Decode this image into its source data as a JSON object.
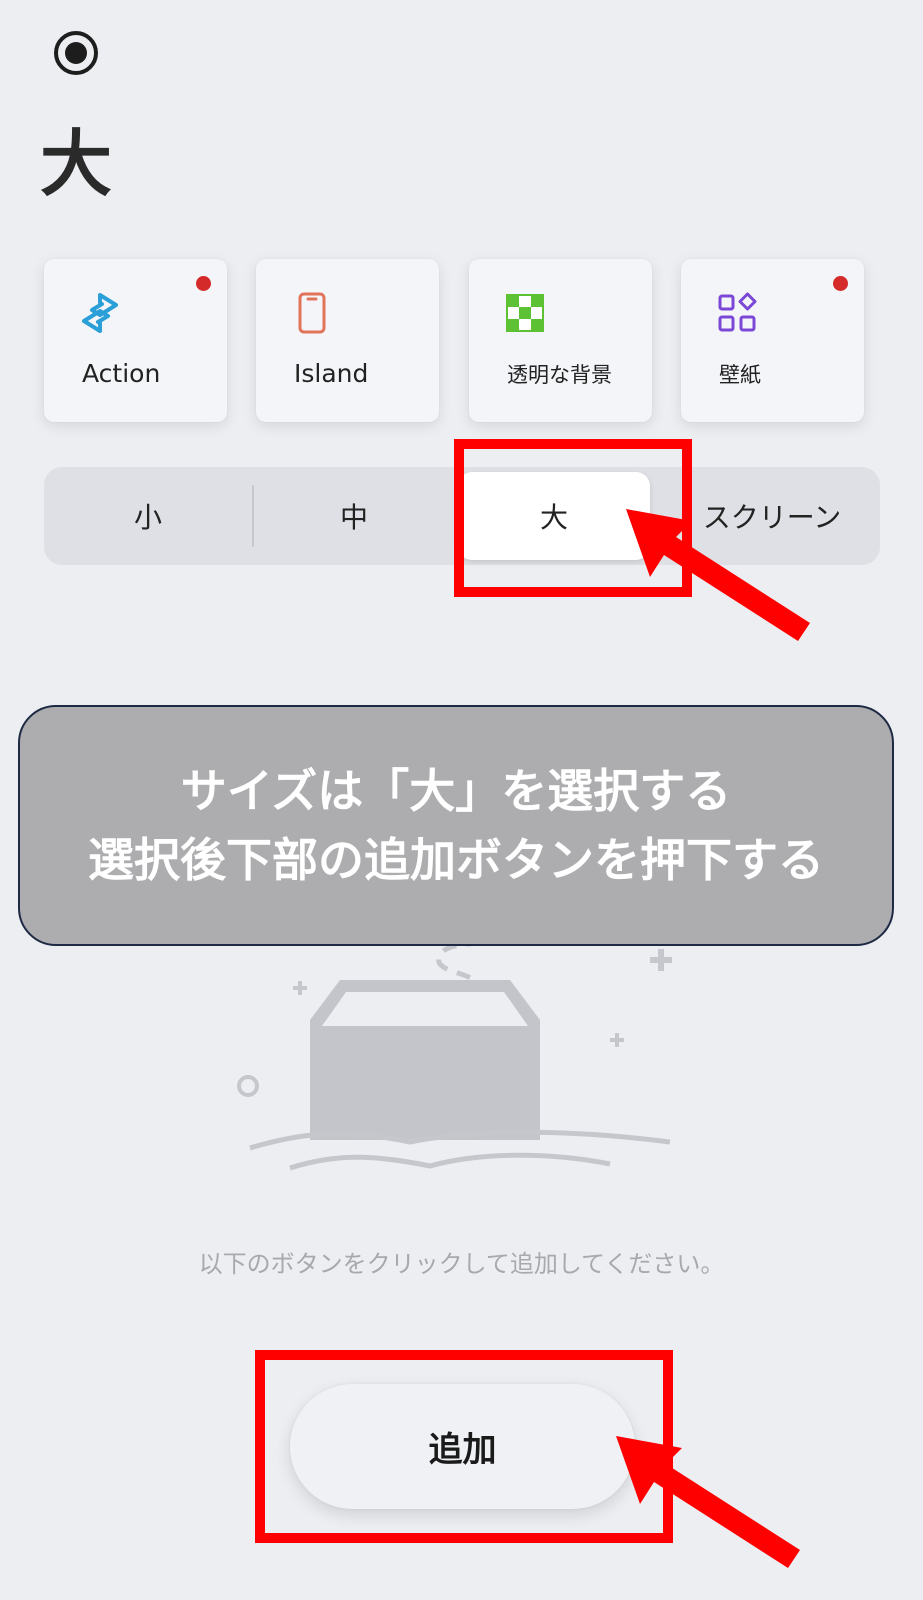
{
  "header": {
    "radio_selected": true,
    "title": "大"
  },
  "cards": [
    {
      "label": "Action",
      "icon": "action-link-icon",
      "badge": true,
      "icon_color": "#2a9fd8"
    },
    {
      "label": "Island",
      "icon": "phone-icon",
      "badge": false,
      "icon_color": "#e2735a"
    },
    {
      "label": "透明な背景",
      "icon": "checker-icon",
      "badge": false,
      "icon_color": "#5cc234"
    },
    {
      "label": "壁紙",
      "icon": "widgets-grid-icon",
      "badge": true,
      "icon_color": "#7a47d6"
    }
  ],
  "size_selector": {
    "options": [
      "小",
      "中",
      "大",
      "スクリーン"
    ],
    "selected": "大"
  },
  "callout": {
    "line1": "サイズは「大」を選択する",
    "line2": "選択後下部の追加ボタンを押下する"
  },
  "empty_state": {
    "message": "以下のボタンをクリックして追加してください。",
    "illustration": "empty-inbox-illustration"
  },
  "add_button": {
    "label": "追加"
  },
  "colors": {
    "background": "#eceef2",
    "highlight": "#ff0000",
    "badge": "#d42a2a",
    "callout_bg": "#adadb0"
  }
}
